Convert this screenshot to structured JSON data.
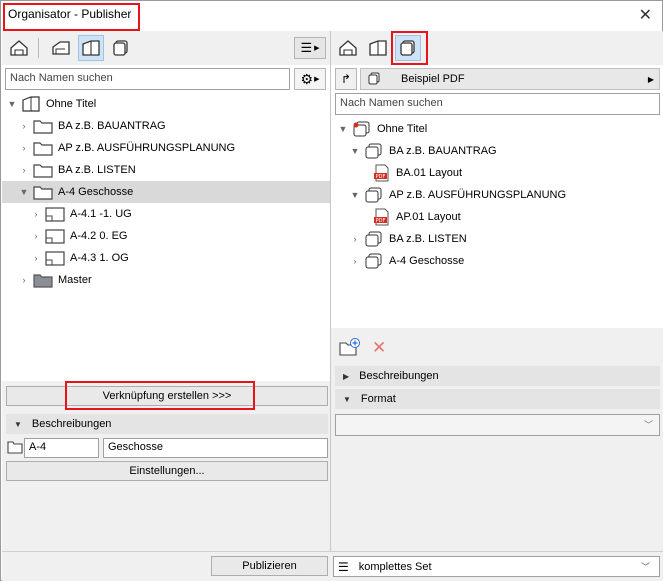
{
  "window": {
    "title": "Organisator - Publisher",
    "close_icon": "close-icon"
  },
  "left": {
    "search_placeholder": "Nach Namen suchen",
    "tree": [
      {
        "label": "Ohne Titel",
        "level": 0,
        "expanded": true,
        "icon": "layout-book-icon"
      },
      {
        "label": "BA z.B. BAUANTRAG",
        "level": 1,
        "expanded": false,
        "icon": "folder-icon"
      },
      {
        "label": "AP z.B. AUSFÜHRUNGSPLANUNG",
        "level": 1,
        "expanded": false,
        "icon": "folder-icon"
      },
      {
        "label": "BA z.B. LISTEN",
        "level": 1,
        "expanded": false,
        "icon": "folder-icon"
      },
      {
        "label": "A-4 Geschosse",
        "level": 1,
        "expanded": true,
        "selected": true,
        "icon": "folder-icon"
      },
      {
        "label": "A-4.1 -1. UG",
        "level": 2,
        "expanded": false,
        "icon": "layout-icon"
      },
      {
        "label": "A-4.2 0. EG",
        "level": 2,
        "expanded": false,
        "icon": "layout-icon"
      },
      {
        "label": "A-4.3 1. OG",
        "level": 2,
        "expanded": false,
        "icon": "layout-icon"
      },
      {
        "label": "Master",
        "level": 1,
        "expanded": false,
        "icon": "folder-dark-icon"
      }
    ],
    "link_button": "Verknüpfung erstellen >>>",
    "descriptions_header": "Beschreibungen",
    "id_value": "A-4",
    "name_value": "Geschosse",
    "settings_button": "Einstellungen..."
  },
  "right": {
    "publisher_set": "Beispiel PDF",
    "search_placeholder": "Nach Namen suchen",
    "tree": [
      {
        "label": "Ohne Titel",
        "level": 0,
        "expanded": true,
        "icon": "publisher-root-icon"
      },
      {
        "label": "BA z.B. BAUANTRAG",
        "level": 1,
        "expanded": true,
        "icon": "publisher-folder-icon"
      },
      {
        "label": "BA.01 Layout",
        "level": 2,
        "icon": "pdf-icon"
      },
      {
        "label": "AP z.B. AUSFÜHRUNGSPLANUNG",
        "level": 1,
        "expanded": true,
        "icon": "publisher-folder-icon"
      },
      {
        "label": "AP.01 Layout",
        "level": 2,
        "icon": "pdf-icon"
      },
      {
        "label": "BA z.B. LISTEN",
        "level": 1,
        "expanded": false,
        "icon": "publisher-folder-icon"
      },
      {
        "label": "A-4 Geschosse",
        "level": 1,
        "expanded": false,
        "icon": "publisher-folder-icon"
      }
    ],
    "descriptions_header": "Beschreibungen",
    "format_header": "Format",
    "format_value": ""
  },
  "bottom": {
    "publish_button": "Publizieren",
    "set_value": "komplettes Set"
  },
  "colors": {
    "highlight": "#e8141c",
    "active_tab": "#cfe3f7",
    "selected_row": "#d9d9d9"
  }
}
